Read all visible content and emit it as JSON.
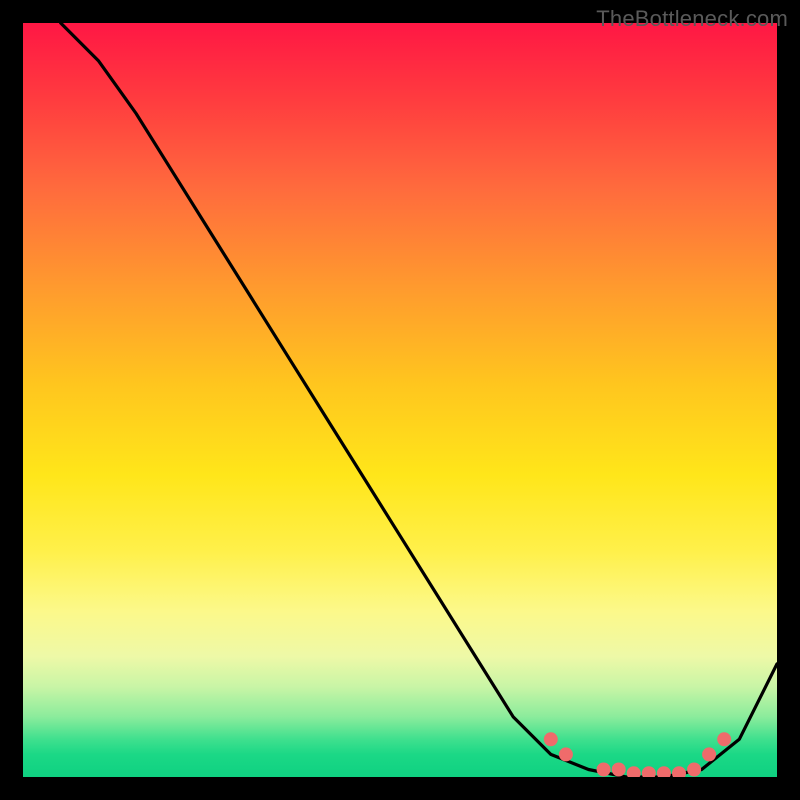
{
  "watermark": "TheBottleneck.com",
  "colors": {
    "background": "#000000",
    "gradient_top": "#ff1744",
    "gradient_mid": "#ffe61a",
    "gradient_bottom": "#0fd181",
    "curve": "#000000",
    "markers": "#ef6b6b"
  },
  "chart_data": {
    "type": "line",
    "title": "",
    "xlabel": "",
    "ylabel": "",
    "xlim": [
      0,
      100
    ],
    "ylim": [
      0,
      100
    ],
    "series": [
      {
        "name": "bottleneck-curve",
        "x": [
          5,
          10,
          15,
          20,
          25,
          30,
          35,
          40,
          45,
          50,
          55,
          60,
          65,
          70,
          75,
          80,
          85,
          90,
          95,
          100
        ],
        "values": [
          100,
          95,
          88,
          80,
          72,
          64,
          56,
          48,
          40,
          32,
          24,
          16,
          8,
          3,
          1,
          0,
          0,
          1,
          5,
          15
        ]
      }
    ],
    "markers": {
      "name": "highlighted-points",
      "x": [
        70,
        72,
        77,
        79,
        81,
        83,
        85,
        87,
        89,
        91,
        93
      ],
      "values": [
        5,
        3,
        1,
        1,
        0.5,
        0.5,
        0.5,
        0.5,
        1,
        3,
        5
      ]
    }
  }
}
